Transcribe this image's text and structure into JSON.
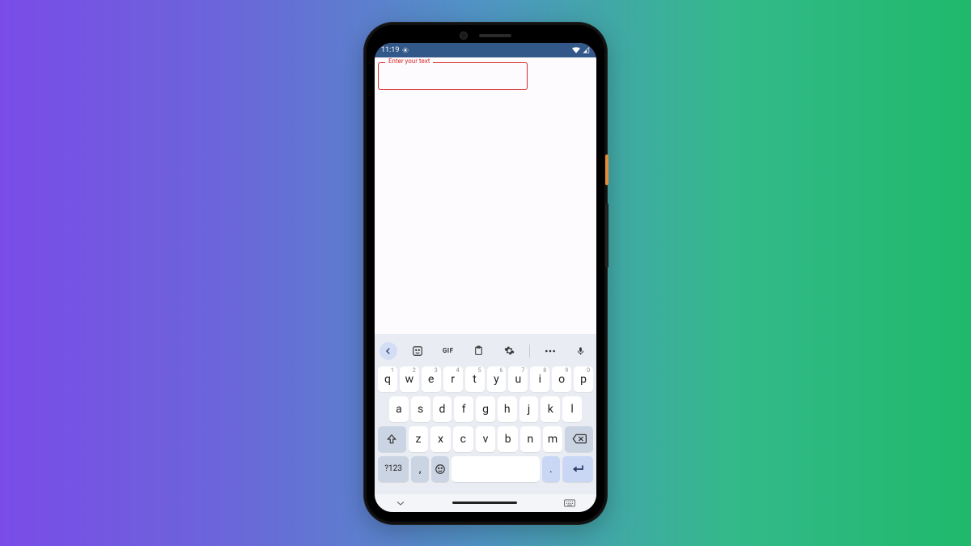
{
  "statusbar": {
    "time": "11:19"
  },
  "input": {
    "label": "Enter your text",
    "value": ""
  },
  "keyboard": {
    "toolbar_gif": "GIF",
    "row1": [
      {
        "k": "q",
        "n": "1"
      },
      {
        "k": "w",
        "n": "2"
      },
      {
        "k": "e",
        "n": "3"
      },
      {
        "k": "r",
        "n": "4"
      },
      {
        "k": "t",
        "n": "5"
      },
      {
        "k": "y",
        "n": "6"
      },
      {
        "k": "u",
        "n": "7"
      },
      {
        "k": "i",
        "n": "8"
      },
      {
        "k": "o",
        "n": "9"
      },
      {
        "k": "p",
        "n": "0"
      }
    ],
    "row2": [
      "a",
      "s",
      "d",
      "f",
      "g",
      "h",
      "j",
      "k",
      "l"
    ],
    "row3": [
      "z",
      "x",
      "c",
      "v",
      "b",
      "n",
      "m"
    ],
    "sym": "?123",
    "comma": ",",
    "period": "."
  }
}
